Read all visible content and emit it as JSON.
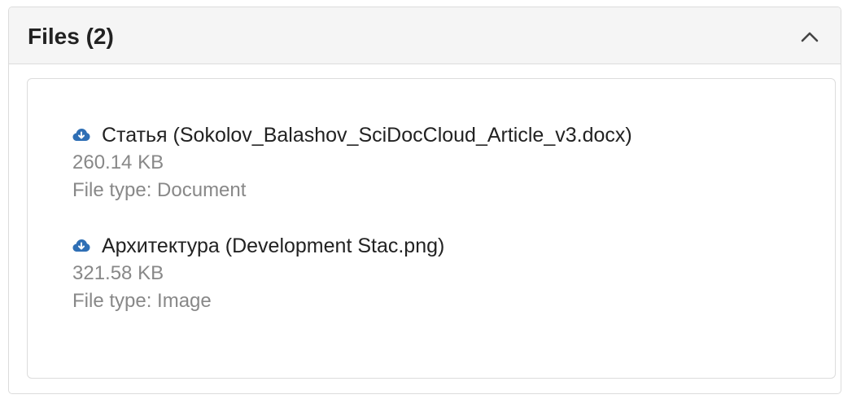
{
  "panel": {
    "title": "Files (2)",
    "collapse_icon": "chevron-up-icon"
  },
  "files": [
    {
      "name": "Статья (Sokolov_Balashov_SciDocCloud_Article_v3.docx)",
      "size": "260.14 KB",
      "type": "File type: Document",
      "icon": "cloud-download-icon"
    },
    {
      "name": "Архитектура (Development Stac.png)",
      "size": "321.58 KB",
      "type": "File type: Image",
      "icon": "cloud-download-icon"
    }
  ],
  "colors": {
    "icon_accent": "#2f6fb5",
    "header_bg": "#f5f5f5",
    "meta_text": "#888888"
  }
}
